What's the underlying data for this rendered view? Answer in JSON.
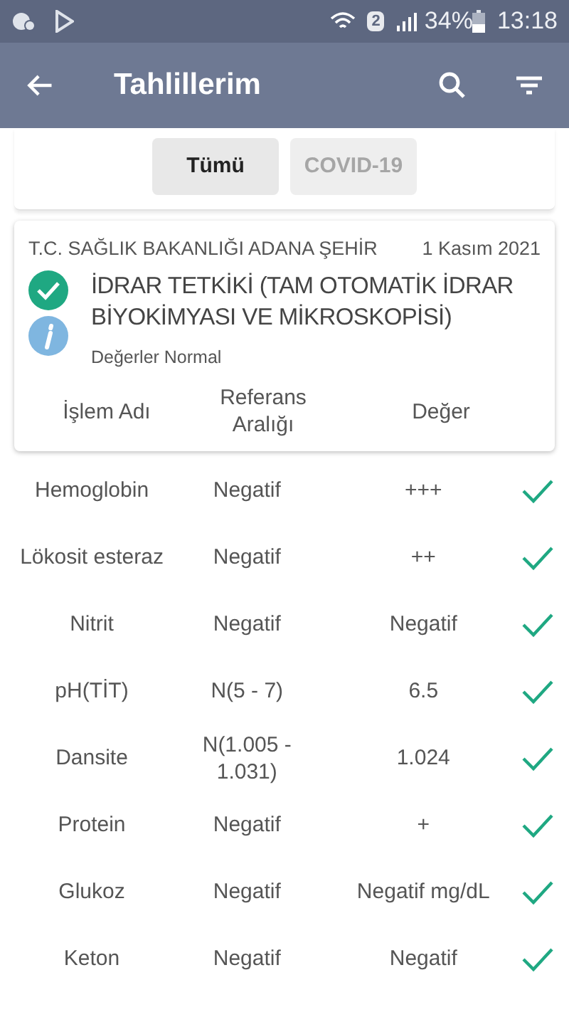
{
  "status_bar": {
    "sim": "2",
    "battery": "34%",
    "time": "13:18"
  },
  "toolbar": {
    "title": "Tahlillerim"
  },
  "filters": [
    {
      "label": "Tümü",
      "selected": true
    },
    {
      "label": "COVID-19",
      "selected": false
    }
  ],
  "report": {
    "institution": "T.C. SAĞLIK BAKANLIĞI ADANA ŞEHİR",
    "date": "1 Kasım 2021",
    "title": "İDRAR TETKİKİ (TAM OTOMATİK İDRAR BİYOKİMYASI VE MİKROSKOPİSİ)",
    "normal": true,
    "summary": "Değerler Normal",
    "columns": [
      "İşlem Adı",
      "Referans Aralığı",
      "Değer"
    ]
  },
  "rows": [
    {
      "name": "Hemoglobin",
      "reference": "Negatif",
      "value": "+++",
      "normal": true
    },
    {
      "name": "Lökosit esteraz",
      "reference": "Negatif",
      "value": "++",
      "normal": true
    },
    {
      "name": "Nitrit",
      "reference": "Negatif",
      "value": "Negatif",
      "normal": true
    },
    {
      "name": "pH(TİT)",
      "reference": "N(5 - 7)",
      "value": "6.5",
      "normal": true
    },
    {
      "name": "Dansite",
      "reference": "N(1.005 - 1.031)",
      "value": "1.024",
      "normal": true
    },
    {
      "name": "Protein",
      "reference": "Negatif",
      "value": "+",
      "normal": true
    },
    {
      "name": "Glukoz",
      "reference": "Negatif",
      "value": "Negatif mg/dL",
      "normal": true
    },
    {
      "name": "Keton",
      "reference": "Negatif",
      "value": "Negatif",
      "normal": true
    }
  ]
}
